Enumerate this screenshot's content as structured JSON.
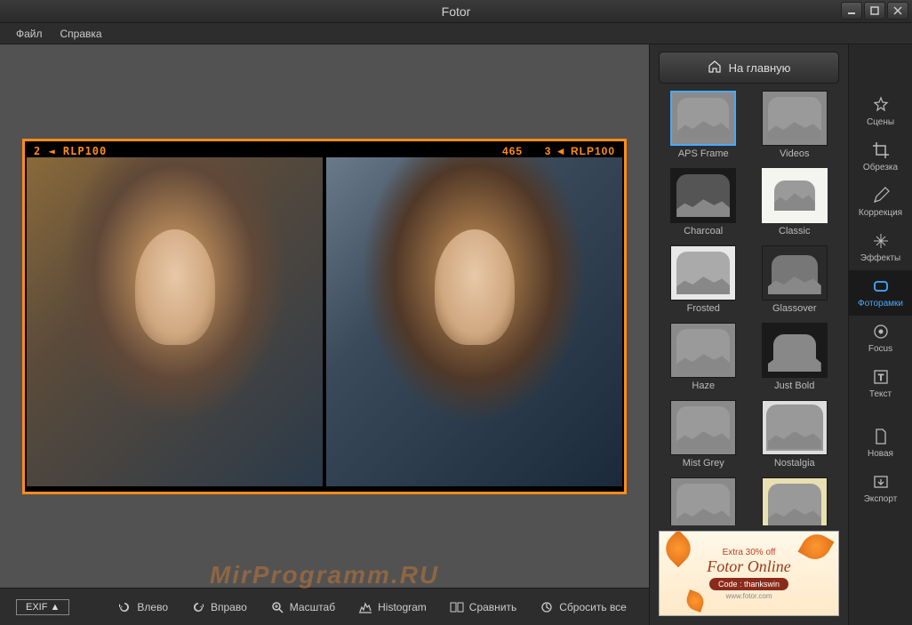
{
  "app_title": "Fotor",
  "menu": {
    "file": "Файл",
    "help": "Справка"
  },
  "home_button": "На главную",
  "film_labels": {
    "left": "2 ◄ RLP100",
    "right_num": "465",
    "right": "3 ◄ RLP100"
  },
  "toolbar": {
    "exif": "EXIF ▲",
    "rotate_left": "Влево",
    "rotate_right": "Вправо",
    "zoom": "Масштаб",
    "histogram": "Histogram",
    "compare": "Сравнить",
    "reset": "Сбросить все"
  },
  "frames": [
    {
      "id": "aps-frame",
      "label": "APS Frame",
      "selected": true
    },
    {
      "id": "videos",
      "label": "Videos"
    },
    {
      "id": "charcoal",
      "label": "Charcoal"
    },
    {
      "id": "classic",
      "label": "Classic"
    },
    {
      "id": "frosted",
      "label": "Frosted"
    },
    {
      "id": "glassover",
      "label": "Glassover"
    },
    {
      "id": "haze",
      "label": "Haze"
    },
    {
      "id": "just-bold",
      "label": "Just Bold"
    },
    {
      "id": "mist-grey",
      "label": "Mist Grey"
    },
    {
      "id": "nostalgia",
      "label": "Nostalgia"
    },
    {
      "id": "plain",
      "label": ""
    },
    {
      "id": "yellowish",
      "label": ""
    }
  ],
  "tools": {
    "scenes": "Сцены",
    "crop": "Обрезка",
    "correction": "Коррекция",
    "effects": "Эффекты",
    "frames": "Фоторамки",
    "focus": "Focus",
    "text": "Текст",
    "new": "Новая",
    "export": "Экспорт"
  },
  "ad": {
    "extra": "Extra 30% off",
    "title": "Fotor Online",
    "code": "Code : thankswin",
    "url": "www.fotor.com"
  },
  "watermark": "MirProgramm.RU"
}
